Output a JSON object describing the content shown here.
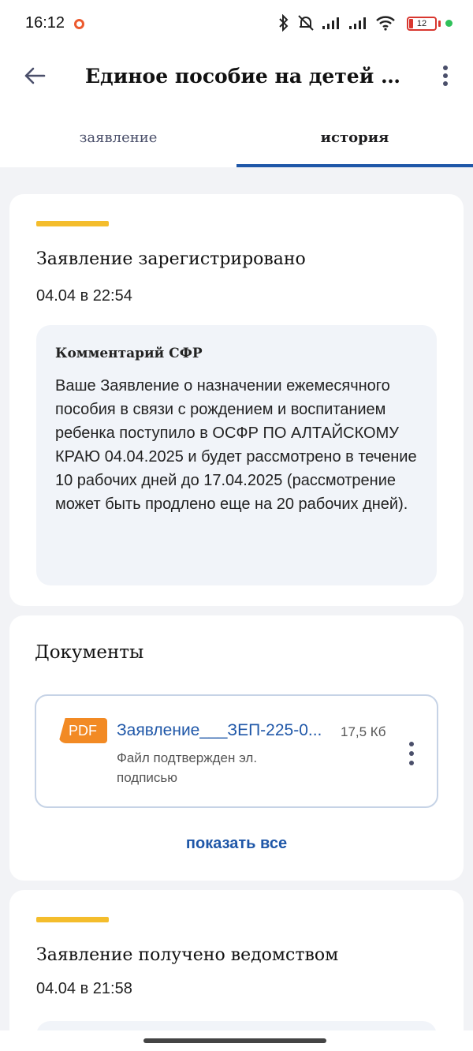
{
  "status_bar": {
    "time": "16:12",
    "battery_level": "12",
    "icons": [
      "recording-icon",
      "bluetooth-icon",
      "muted-icon",
      "signal-icon",
      "signal-icon",
      "wifi-icon",
      "battery-icon",
      "active-dot-icon"
    ],
    "colors": {
      "battery": "#d8372f",
      "active_dot": "#2fc15a",
      "recording": "#ec5a2e"
    }
  },
  "app_bar": {
    "title": "Единое пособие на детей и бе..."
  },
  "tabs": [
    {
      "label": "заявление",
      "active": false
    },
    {
      "label": "история",
      "active": true
    }
  ],
  "history": [
    {
      "title": "Заявление зарегистрировано",
      "date": "04.04 в 22:54",
      "comment_title": "Комментарий СФР",
      "comment_text": "Ваше Заявление о назначении ежемесячного пособия в связи с рождением и воспитанием ребенка поступило в ОСФР ПО АЛТАЙСКОМУ КРАЮ 04.04.2025 и будет рассмотрено в течение 10 рабочих дней до 17.04.2025 (рассмотрение может быть продлено еще на 20 рабочих дней)."
    },
    {
      "title": "Заявление получено ведомством",
      "date": "04.04 в 21:58"
    }
  ],
  "documents": {
    "title": "Документы",
    "items": [
      {
        "badge": "PDF",
        "name": "Заявление___ЗЕП-225-0...",
        "size": "17,5 Кб",
        "note": "Файл подтвержден эл. подписью"
      }
    ],
    "show_all": "показать все"
  },
  "colors": {
    "accent_line": "#f4bd2c",
    "link": "#1f57a8",
    "pdf_badge": "#f28a24"
  }
}
